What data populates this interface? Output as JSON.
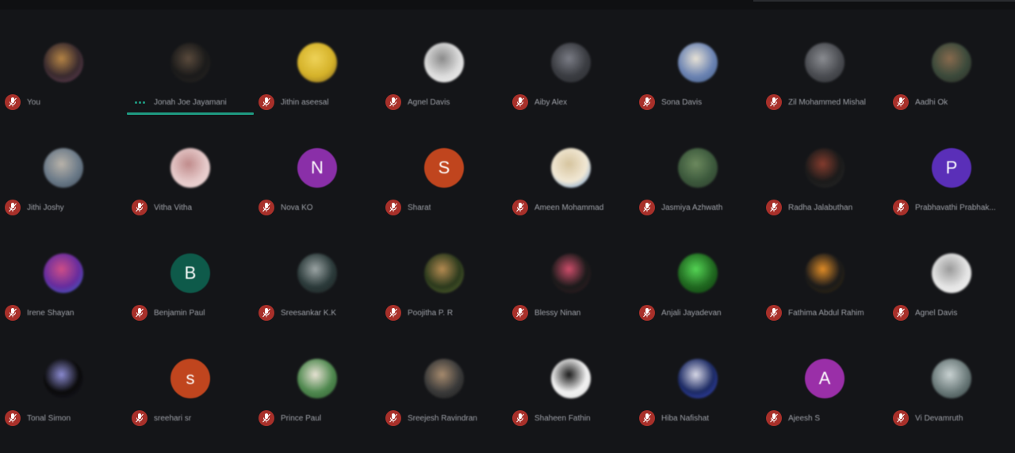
{
  "accent_speaking": "#1f9a82",
  "mic_muted_color": "#a8302a",
  "participants": [
    {
      "name": "You",
      "avatar_type": "photo",
      "colors": [
        "#3a2a2e",
        "#b9823d",
        "#6a3b5a"
      ],
      "mic": "muted"
    },
    {
      "name": "Jonah Joe Jayamani",
      "avatar_type": "photo",
      "colors": [
        "#1a1a1a",
        "#5b4a3a",
        "#2a2622"
      ],
      "mic": "speaking"
    },
    {
      "name": "Jithin aseesal",
      "avatar_type": "photo",
      "colors": [
        "#d9b21a",
        "#f2d24a",
        "#7a5a18"
      ],
      "mic": "muted"
    },
    {
      "name": "Agnel Davis",
      "avatar_type": "photo",
      "colors": [
        "#dcdcdc",
        "#8a8a8a",
        "#f4f4f4"
      ],
      "mic": "muted"
    },
    {
      "name": "Aiby Alex",
      "avatar_type": "photo",
      "colors": [
        "#3a3c42",
        "#7a7c86",
        "#2a2c30"
      ],
      "mic": "muted"
    },
    {
      "name": "Sona Davis",
      "avatar_type": "photo",
      "colors": [
        "#6a84b8",
        "#e8e2d4",
        "#3a5a8a"
      ],
      "mic": "muted"
    },
    {
      "name": "Zil Mohammed Mishal",
      "avatar_type": "photo",
      "colors": [
        "#4a4c52",
        "#8a8c92",
        "#2a2c30"
      ],
      "mic": "muted"
    },
    {
      "name": "Aadhi Ok",
      "avatar_type": "photo",
      "colors": [
        "#3a4a3a",
        "#8a6a4a",
        "#2a2a22"
      ],
      "mic": "muted"
    },
    {
      "name": "Jithi Joshy",
      "avatar_type": "photo",
      "colors": [
        "#6a7a8a",
        "#b8b2a8",
        "#3a4a5a"
      ],
      "mic": "muted"
    },
    {
      "name": "Vitha Vitha",
      "avatar_type": "photo",
      "colors": [
        "#e8c8c8",
        "#c48a8a",
        "#f2dcdc"
      ],
      "mic": "muted"
    },
    {
      "name": "Nova KO",
      "avatar_type": "letter",
      "letter": "N",
      "bg": "#8a2fa8",
      "mic": "muted"
    },
    {
      "name": "Sharat",
      "avatar_type": "letter",
      "letter": "S",
      "bg": "#c0451e",
      "mic": "muted"
    },
    {
      "name": "Ameen Mohammad",
      "avatar_type": "photo",
      "colors": [
        "#f2e8d2",
        "#d8c49a",
        "#4a8ad8"
      ],
      "mic": "muted"
    },
    {
      "name": "Jasmiya Azhwath",
      "avatar_type": "photo",
      "colors": [
        "#3a5a3a",
        "#6a8a5a",
        "#2a3a2a"
      ],
      "mic": "muted"
    },
    {
      "name": "Radha Jalabuthan",
      "avatar_type": "photo",
      "colors": [
        "#1a1a1a",
        "#8a3a2a",
        "#2a2a2a"
      ],
      "mic": "muted"
    },
    {
      "name": "Prabhavathi Prabhak...",
      "avatar_type": "letter",
      "letter": "P",
      "bg": "#5a2fb8",
      "mic": "muted"
    },
    {
      "name": "Irene Shayan",
      "avatar_type": "photo",
      "colors": [
        "#6a2aa8",
        "#d84a8a",
        "#2a6ad8"
      ],
      "mic": "muted"
    },
    {
      "name": "Benjamin Paul",
      "avatar_type": "letter",
      "letter": "B",
      "bg": "#0e5a4a",
      "mic": "muted"
    },
    {
      "name": "Sreesankar K.K",
      "avatar_type": "photo",
      "colors": [
        "#2a3a3a",
        "#9aa4a4",
        "#1a2020"
      ],
      "mic": "muted"
    },
    {
      "name": "Poojitha P. R",
      "avatar_type": "photo",
      "colors": [
        "#2a3a1a",
        "#b88a4a",
        "#5a6a2a"
      ],
      "mic": "muted"
    },
    {
      "name": "Blessy Ninan",
      "avatar_type": "photo",
      "colors": [
        "#1a1a1a",
        "#d84a6a",
        "#3a1a22"
      ],
      "mic": "muted"
    },
    {
      "name": "Anjali Jayadevan",
      "avatar_type": "photo",
      "colors": [
        "#1a6a1a",
        "#4ad84a",
        "#0a3a0a"
      ],
      "mic": "muted"
    },
    {
      "name": "Fathima Abdul Rahim",
      "avatar_type": "photo",
      "colors": [
        "#1a1a1a",
        "#e88a1a",
        "#3a2a0a"
      ],
      "mic": "muted"
    },
    {
      "name": "Agnel Davis",
      "avatar_type": "photo",
      "colors": [
        "#e4e4e4",
        "#9a9a9a",
        "#f6f6f6"
      ],
      "mic": "muted"
    },
    {
      "name": "Tonal Simon",
      "avatar_type": "photo",
      "colors": [
        "#0a0a0a",
        "#8a8ad8",
        "#1a1a2a"
      ],
      "mic": "muted"
    },
    {
      "name": "sreehari sr",
      "avatar_type": "letter",
      "letter": "s",
      "bg": "#c0451e",
      "mic": "muted"
    },
    {
      "name": "Prince Paul",
      "avatar_type": "photo",
      "colors": [
        "#4a8a4a",
        "#e8e2d2",
        "#2a5a2a"
      ],
      "mic": "muted"
    },
    {
      "name": "Sreejesh Ravindran",
      "avatar_type": "photo",
      "colors": [
        "#3a3a3a",
        "#a88a6a",
        "#1a1a1a"
      ],
      "mic": "muted"
    },
    {
      "name": "Shaheen Fathin",
      "avatar_type": "photo",
      "colors": [
        "#f2f2f2",
        "#1a1a1a",
        "#d8d8d8"
      ],
      "mic": "muted"
    },
    {
      "name": "Hiba Nafishat",
      "avatar_type": "photo",
      "colors": [
        "#1a2a6a",
        "#d8d8e8",
        "#3a4ad8"
      ],
      "mic": "muted"
    },
    {
      "name": "Ajeesh S",
      "avatar_type": "letter",
      "letter": "A",
      "bg": "#9a2fa8",
      "mic": "muted"
    },
    {
      "name": "Vi Devamruth",
      "avatar_type": "photo",
      "colors": [
        "#6a7a7a",
        "#c8d2d2",
        "#2a3a3a"
      ],
      "mic": "muted"
    }
  ]
}
